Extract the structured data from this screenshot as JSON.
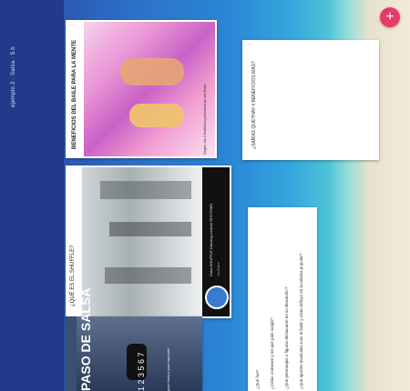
{
  "app": {
    "board_title": "ejemplo 2 · Salsa · 5 h",
    "add_label": "+"
  },
  "cards": [
    {
      "label": "BENEFICIOS DEL BAILE PARA LA MENTE",
      "caption": "Según las Científicas periodísticas del Baile",
      "meta": "sara.c"
    },
    {
      "title": "¿QUÉ ES EL SHUFFLE?",
      "meta_title": "Cuba SHUFFLE Dancing Lecture RHYTHMS",
      "meta_sub": "YouTube"
    },
    {
      "title": "PASO DE SALSA",
      "numbers": "1 2 3 5 6 7",
      "meta": "paso basico para aprender"
    },
    {
      "text": "¿SABÍAS QUÉ?HAY 4 BENEFICIOS MÁS?"
    },
    {
      "lines": [
        "¿Qué fue?",
        "¿Cómo comenzó y en qué país surgió?",
        "¿Qué personajes o figuras destacaron en su desarrollo?",
        "¿Qué aportes musicales tuvo el baile y cómo influyó en la música popular?"
      ]
    }
  ],
  "colors": {
    "fab": "#e83a6a",
    "board_bg": "#213a8a"
  },
  "icons": [
    "plus-icon",
    "more-icon"
  ]
}
